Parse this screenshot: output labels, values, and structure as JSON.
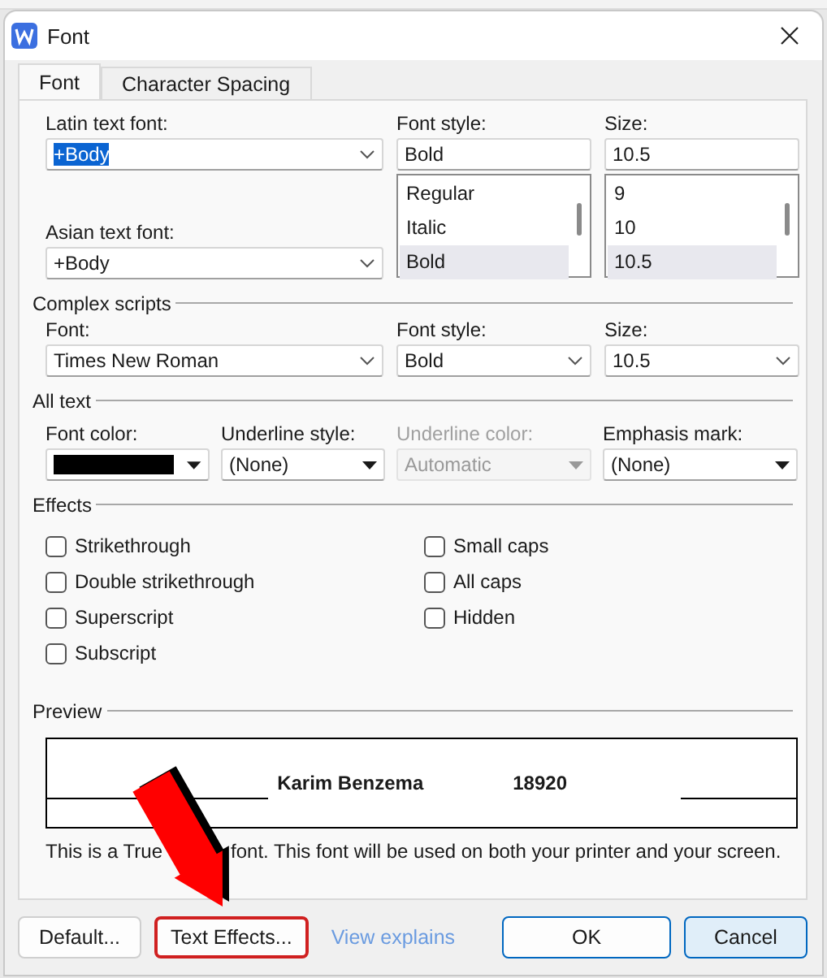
{
  "window": {
    "title": "Font"
  },
  "tabs": [
    {
      "label": "Font",
      "selected": true
    },
    {
      "label": "Character Spacing",
      "selected": false
    }
  ],
  "latin_font": {
    "label": "Latin text font:",
    "value": "+Body"
  },
  "asian_font": {
    "label": "Asian text font:",
    "value": "+Body"
  },
  "font_style": {
    "label": "Font style:",
    "value": "Bold",
    "options": [
      {
        "label": "Regular",
        "selected": false
      },
      {
        "label": "Italic",
        "selected": false
      },
      {
        "label": "Bold",
        "selected": true
      }
    ]
  },
  "size": {
    "label": "Size:",
    "value": "10.5",
    "options": [
      {
        "label": "9",
        "selected": false
      },
      {
        "label": "10",
        "selected": false
      },
      {
        "label": "10.5",
        "selected": true
      }
    ]
  },
  "complex_scripts": {
    "title": "Complex scripts",
    "fields": [
      {
        "label": "Font:",
        "value": "Times New Roman"
      },
      {
        "label": "Font style:",
        "value": "Bold"
      },
      {
        "label": "Size:",
        "value": "10.5"
      }
    ]
  },
  "all_text": {
    "title": "All text",
    "fields": [
      {
        "kind": "color",
        "label": "Font color:",
        "color": "#000000",
        "disabled": false
      },
      {
        "kind": "select",
        "label": "Underline style:",
        "value": "(None)",
        "disabled": false
      },
      {
        "kind": "select",
        "label": "Underline color:",
        "value": "Automatic",
        "disabled": true
      },
      {
        "kind": "combo",
        "label": "Emphasis mark:",
        "value": "(None)",
        "disabled": false
      }
    ]
  },
  "effects": {
    "title": "Effects",
    "columns": [
      [
        {
          "label": "Strikethrough",
          "checked": false
        },
        {
          "label": "Double strikethrough",
          "checked": false
        },
        {
          "label": "Superscript",
          "checked": false
        },
        {
          "label": "Subscript",
          "checked": false
        }
      ],
      [
        {
          "label": "Small caps",
          "checked": false
        },
        {
          "label": "All caps",
          "checked": false
        },
        {
          "label": "Hidden",
          "checked": false
        }
      ]
    ]
  },
  "preview": {
    "title": "Preview",
    "sample": "Karim Benzema",
    "number": "18920",
    "note_start": "This is a True",
    "note_end": "font. This font will be used on both your printer and your screen."
  },
  "buttons": [
    {
      "kind": "button",
      "label": "Default...",
      "highlighted": false,
      "hovered": false
    },
    {
      "kind": "button",
      "label": "Text Effects...",
      "highlighted": true,
      "hovered": false
    },
    {
      "kind": "link",
      "label": "View explains"
    },
    {
      "kind": "primary",
      "label": "OK",
      "highlighted": false,
      "hovered": false
    },
    {
      "kind": "button",
      "label": "Cancel",
      "highlighted": false,
      "hovered": true
    }
  ]
}
